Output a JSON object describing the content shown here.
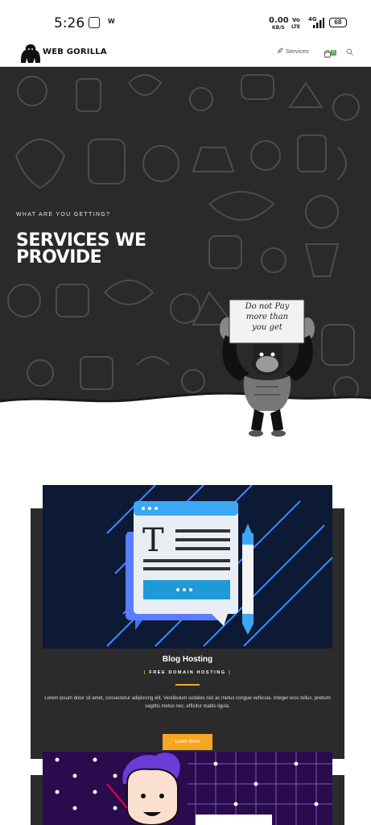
{
  "status_bar": {
    "time": "5:26",
    "net_speed": "0.00",
    "net_unit": "KB/S",
    "volte": "Vo",
    "lte": "LTE",
    "network": "4G",
    "battery": "68"
  },
  "navbar": {
    "logo_text": "WEB GORILLA",
    "services_label": "Services",
    "cart_count": "0",
    "accent_color": "#4caf50"
  },
  "hero": {
    "eyebrow": "WHAT ARE YOU GETTING?",
    "title_line1": "SERVICES WE",
    "title_line2": "PROVIDE",
    "sign_line1": "Do not Pay",
    "sign_line2": "more than",
    "sign_line3": "you get",
    "bg_color": "#2a2a2a"
  },
  "cards": [
    {
      "title": "Blog Hosting",
      "subtitle_open": "[",
      "subtitle": "FREE DOMAIN HOSTING",
      "subtitle_close": "]",
      "description": "Lorem ipsum dolor sit amet, consectetur adipiscing elit. Vestibulum sodales nisl ac metus congue vehicula. Integer eros tellus, pretium sagittis metus nec, efficitur mattis ligula.",
      "button_label": "Learn More",
      "accent_color": "#f5a623"
    }
  ]
}
